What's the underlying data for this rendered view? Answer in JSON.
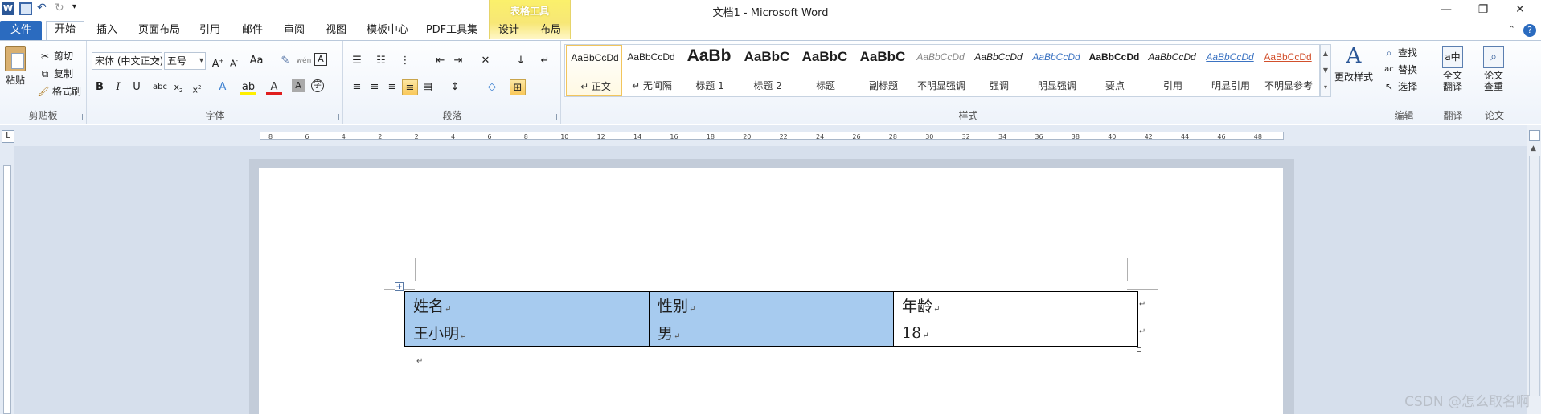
{
  "window": {
    "title": "文档1 - Microsoft Word",
    "contextual_group": "表格工具",
    "minimize": "—",
    "restore": "❐",
    "close": "✕"
  },
  "tabs": [
    "文件",
    "开始",
    "插入",
    "页面布局",
    "引用",
    "邮件",
    "审阅",
    "视图",
    "模板中心",
    "PDF工具集",
    "设计",
    "布局"
  ],
  "clipboard": {
    "paste": "粘贴",
    "cut": "剪切",
    "copy": "复制",
    "format_painter": "格式刷",
    "label": "剪贴板"
  },
  "font": {
    "family": "宋体 (中文正文)",
    "size": "五号",
    "label": "字体"
  },
  "paragraph": {
    "label": "段落"
  },
  "styles": {
    "label": "样式",
    "items": [
      {
        "sample": "AaBbCcDd",
        "name": "↵ 正文"
      },
      {
        "sample": "AaBbCcDd",
        "name": "↵ 无间隔"
      },
      {
        "sample": "AaBb",
        "name": "标题 1"
      },
      {
        "sample": "AaBbC",
        "name": "标题 2"
      },
      {
        "sample": "AaBbC",
        "name": "标题"
      },
      {
        "sample": "AaBbC",
        "name": "副标题"
      },
      {
        "sample": "AaBbCcDd",
        "name": "不明显强调"
      },
      {
        "sample": "AaBbCcDd",
        "name": "强调"
      },
      {
        "sample": "AaBbCcDd",
        "name": "明显强调"
      },
      {
        "sample": "AaBbCcDd",
        "name": "要点"
      },
      {
        "sample": "AaBbCcDd",
        "name": "引用"
      },
      {
        "sample": "AaBbCcDd",
        "name": "明显引用"
      },
      {
        "sample": "AaBbCcDd",
        "name": "不明显参考"
      }
    ],
    "change": "更改样式"
  },
  "editing": {
    "find": "查找",
    "replace": "替换",
    "select": "选择",
    "label": "编辑"
  },
  "translate": {
    "full": "全文翻译",
    "label": "翻译"
  },
  "thesis": {
    "check": "论文查重",
    "label": "论文"
  },
  "ruler_ticks": [
    "8",
    "6",
    "4",
    "2",
    "2",
    "4",
    "6",
    "8",
    "10",
    "12",
    "14",
    "16",
    "18",
    "20",
    "22",
    "24",
    "26",
    "28",
    "30",
    "32",
    "34",
    "36",
    "38",
    "40",
    "42",
    "44",
    "46",
    "48"
  ],
  "table": {
    "rows": [
      [
        "姓名",
        "性别",
        "年龄"
      ],
      [
        "王小明",
        "男",
        "18"
      ]
    ]
  },
  "watermark": "CSDN @怎么取名啊",
  "colors": {
    "accent": "#2b6bbf",
    "selection": "#a7cbef",
    "contextual": "#f7e776"
  }
}
